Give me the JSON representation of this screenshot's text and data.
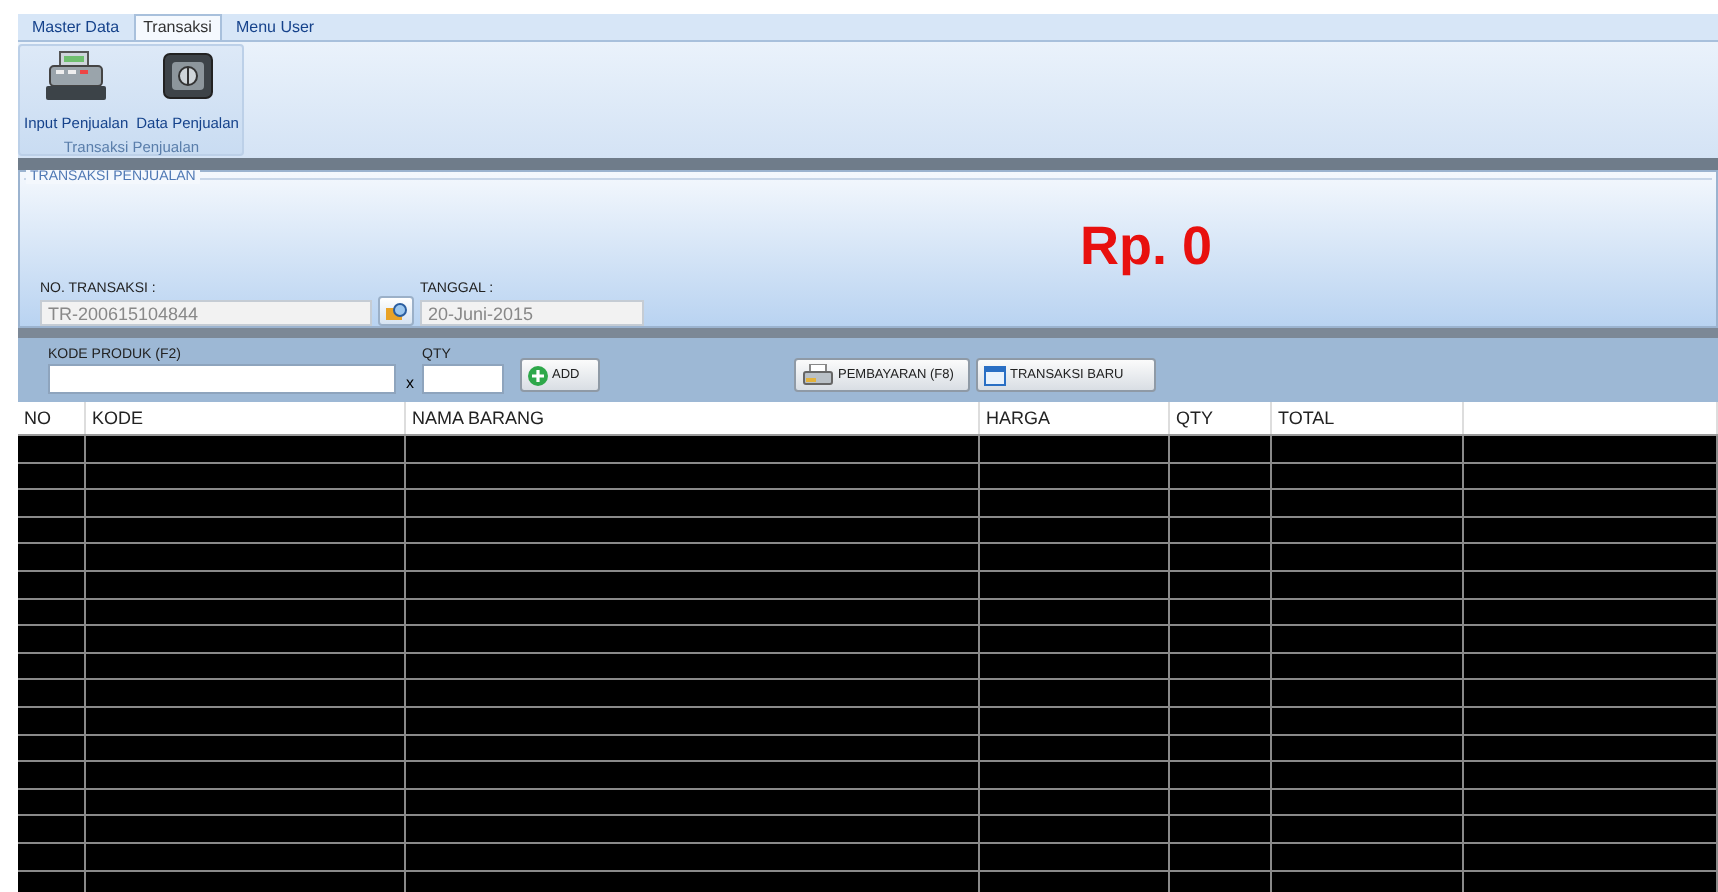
{
  "ribbon": {
    "tabs": [
      {
        "label": "Master Data",
        "selected": false
      },
      {
        "label": "Transaksi",
        "selected": true
      },
      {
        "label": "Menu User",
        "selected": false
      }
    ],
    "groups": [
      {
        "title": "Transaksi Penjualan",
        "buttons": [
          {
            "label": "Input Penjualan",
            "kind": "register"
          },
          {
            "label": "Data Penjualan",
            "kind": "safe"
          }
        ]
      }
    ]
  },
  "transaction": {
    "legend": "TRANSAKSI PENJUALAN",
    "no_label": "NO. TRANSAKSI :",
    "no_value": "TR-200615104844",
    "date_label": "TANGGAL :",
    "date_value": "20-Juni-2015",
    "total": "Rp. 0"
  },
  "entry": {
    "code_label": "KODE PRODUK (F2)",
    "times": "x",
    "qty_label": "QTY",
    "add_button": "ADD",
    "pay_button": "PEMBAYARAN (F8)",
    "new_button": "TRANSAKSI BARU"
  },
  "table": {
    "columns": [
      "NO",
      "KODE",
      "NAMA BARANG",
      "HARGA",
      "QTY",
      "TOTAL"
    ]
  }
}
